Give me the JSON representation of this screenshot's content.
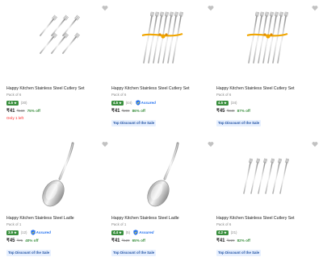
{
  "products": [
    {
      "title": "Happy Kitchen Stainless Steel Cutlery Set",
      "pack": "Pack of 6",
      "rating": "4.5",
      "count": "(30)",
      "assured": false,
      "price": "₹41",
      "mrp": "₹169",
      "off": "75% off",
      "stock": "Only 1 left",
      "tag": "",
      "image": "forks-plain"
    },
    {
      "title": "Happy Kitchen Stainless Steel Cutlery Set",
      "pack": "Pack of 6",
      "rating": "4.5",
      "count": "(44)",
      "assured": true,
      "assured_label": "Assured",
      "price": "₹41",
      "mrp": "₹299",
      "off": "86% off",
      "stock": "",
      "tag": "Top Discount of the Sale",
      "image": "forks-ribbon"
    },
    {
      "title": "Happy Kitchen Stainless Steel Cutlery Set",
      "pack": "Pack of 6",
      "rating": "4.5",
      "count": "(34)",
      "assured": false,
      "price": "₹45",
      "mrp": "₹349",
      "off": "87% off",
      "stock": "",
      "tag": "Top Discount of the Sale",
      "image": "forks-ribbon"
    },
    {
      "title": "Happy Kitchen Stainless Steel Ladle",
      "pack": "Pack of 1",
      "rating": "3.9",
      "count": "(12)",
      "assured": true,
      "assured_label": "Assured",
      "price": "₹45",
      "mrp": "₹75",
      "off": "40% off",
      "stock": "",
      "tag": "Top Discount of the Sale",
      "image": "ladle"
    },
    {
      "title": "Happy Kitchen Stainless Steel Ladle",
      "pack": "Pack of 1",
      "rating": "4.4",
      "count": "(5)",
      "assured": true,
      "assured_label": "Assured",
      "price": "₹41",
      "mrp": "₹120",
      "off": "65% off",
      "stock": "",
      "tag": "Top Discount of the Sale",
      "image": "ladle"
    },
    {
      "title": "Happy Kitchen Stainless Steel Cutlery Set",
      "pack": "Pack of 6",
      "rating": "4.2",
      "count": "(21)",
      "assured": false,
      "price": "₹41",
      "mrp": "₹229",
      "off": "82% off",
      "stock": "",
      "tag": "Top Discount of the Sale",
      "image": "forks-row"
    }
  ],
  "colors": {
    "rating_bg": "#388e3c",
    "discount": "#388e3c",
    "stock": "#ff6161",
    "assured": "#2874f0",
    "tag_bg": "#e7f0ff",
    "tag_text": "#2455a5"
  },
  "icons": {
    "wishlist": "heart-icon",
    "star": "star-icon",
    "assured": "assured-shield-icon"
  }
}
